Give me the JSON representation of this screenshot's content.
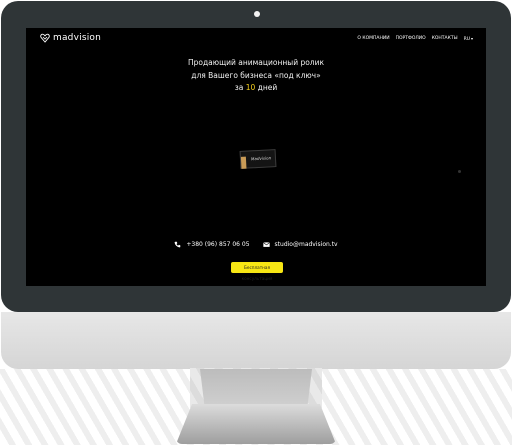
{
  "site": {
    "logo_text": "madvision",
    "nav": [
      "О КОМПАНИИ",
      "ПОРТФОЛИО",
      "КОНТАКТЫ"
    ],
    "lang": "RU"
  },
  "hero": {
    "line1": "Продающий анимационный ролик",
    "line2": "для Вашего бизнеса «под ключ»",
    "line3_prefix": "за",
    "line3_number": "10",
    "line3_suffix": "дней",
    "highlight_color": "#f6d01e"
  },
  "showcase": {
    "card_text": "Madvision"
  },
  "contacts": {
    "phone": "+380 (96) 857 06 05",
    "email": "studio@madvision.tv",
    "cta_label": "Бесплатная консультация",
    "cta_color": "#f7e614"
  },
  "colors": {
    "screen_bg": "#000000",
    "bezel": "#2f3537",
    "stand": "#d9d9d9"
  }
}
